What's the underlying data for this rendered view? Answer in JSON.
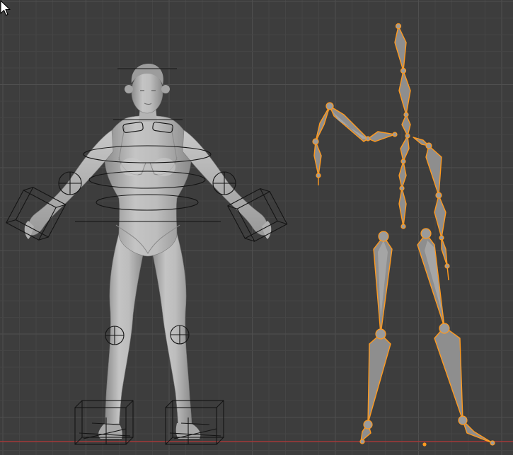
{
  "viewport": {
    "background": "#3d3d3d",
    "grid_color": "#454545",
    "grid_major_color": "#4f4f4f",
    "floor_axis_color": "#b33a3a",
    "selection_color": "#ff9a1f",
    "body_color": "#b9b9b9"
  },
  "icons": {
    "cursor": "mouse-pointer-icon",
    "origin": "object-origin-icon"
  }
}
